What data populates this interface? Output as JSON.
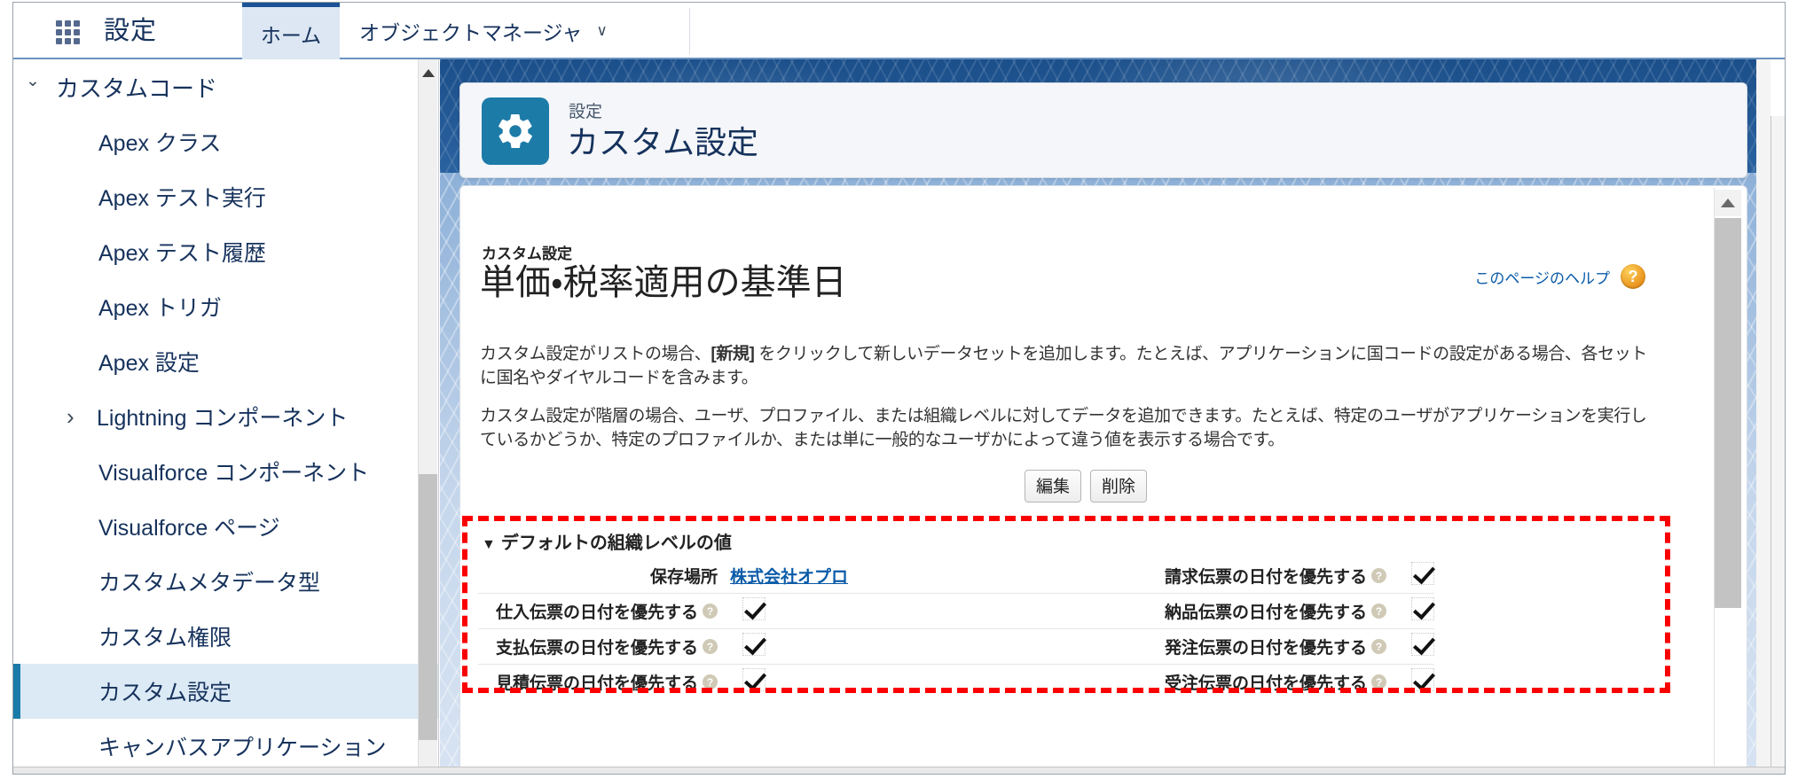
{
  "global_header": {
    "app_launcher_icon": "app-launcher-grid-icon",
    "setup_label": "設定",
    "tabs": [
      {
        "label": "ホーム",
        "active": true
      },
      {
        "label": "オブジェクトマネージャ",
        "active": false,
        "caret": "∨"
      }
    ]
  },
  "sidebar": {
    "items": [
      {
        "label": "カスタムコード",
        "level": 0,
        "twisty": "open",
        "selected": false
      },
      {
        "label": "Apex クラス",
        "level": 1,
        "twisty": "none",
        "selected": false
      },
      {
        "label": "Apex テスト実行",
        "level": 1,
        "twisty": "none",
        "selected": false
      },
      {
        "label": "Apex テスト履歴",
        "level": 1,
        "twisty": "none",
        "selected": false
      },
      {
        "label": "Apex トリガ",
        "level": 1,
        "twisty": "none",
        "selected": false
      },
      {
        "label": "Apex 設定",
        "level": 1,
        "twisty": "none",
        "selected": false
      },
      {
        "label": "Lightning コンポーネント",
        "level": 1,
        "twisty": "closed",
        "selected": false
      },
      {
        "label": "Visualforce コンポーネント",
        "level": 1,
        "twisty": "none",
        "selected": false
      },
      {
        "label": "Visualforce ページ",
        "level": 1,
        "twisty": "none",
        "selected": false
      },
      {
        "label": "カスタムメタデータ型",
        "level": 1,
        "twisty": "none",
        "selected": false
      },
      {
        "label": "カスタム権限",
        "level": 1,
        "twisty": "none",
        "selected": false
      },
      {
        "label": "カスタム設定",
        "level": 1,
        "twisty": "none",
        "selected": true
      },
      {
        "label": "キャンバスアプリケーション",
        "level": 1,
        "twisty": "none",
        "selected": false
      }
    ]
  },
  "page_header": {
    "icon": "gear-icon",
    "eyebrow": "設定",
    "title": "カスタム設定",
    "accent_color": "#1d7ba8"
  },
  "classic_page": {
    "breadcrumb": "カスタム設定",
    "title": "単価・税率適用の基準日",
    "help_link": "このページのヘルプ",
    "help_icon": "question-mark-icon",
    "paragraph_1_before": "カスタム設定がリストの場合、",
    "paragraph_1_bold": "[新規]",
    "paragraph_1_after": " をクリックして新しいデータセットを追加します。たとえば、アプリケーションに国コードの設定がある場合、各セットに国名やダイヤルコードを含みます。",
    "paragraph_2": "カスタム設定が階層の場合、ユーザ、プロファイル、または組織レベルに対してデータを追加できます。たとえば、特定のユーザがアプリケーションを実行しているかどうか、特定のプロファイルか、または単に一般的なユーザかによって違う値を表示する場合です。",
    "buttons": [
      {
        "label": "編集"
      },
      {
        "label": "削除"
      }
    ],
    "section": {
      "twisty": "▼",
      "title": "デフォルトの組織レベルの値",
      "rows": [
        {
          "left_label": "保存場所",
          "left_type": "link",
          "left_value": "株式会社オプロ",
          "left_has_info": false,
          "right_label": "請求伝票の日付を優先する",
          "right_has_info": true,
          "right_checked": true
        },
        {
          "left_label": "仕入伝票の日付を優先する",
          "left_type": "check",
          "left_has_info": true,
          "left_checked": true,
          "right_label": "納品伝票の日付を優先する",
          "right_has_info": true,
          "right_checked": true
        },
        {
          "left_label": "支払伝票の日付を優先する",
          "left_type": "check",
          "left_has_info": true,
          "left_checked": true,
          "right_label": "発注伝票の日付を優先する",
          "right_has_info": true,
          "right_checked": true
        },
        {
          "left_label": "見積伝票の日付を優先する",
          "left_type": "check",
          "left_has_info": true,
          "left_checked": true,
          "right_label": "受注伝票の日付を優先する",
          "right_has_info": true,
          "right_checked": true
        }
      ]
    }
  },
  "annotation": {
    "border_color": "#fb0000",
    "style": "dashed-highlight-box"
  },
  "scrollbars": {
    "sidebar_arrow": "scroll-up-arrow-icon",
    "content_arrow": "scroll-up-arrow-icon"
  }
}
